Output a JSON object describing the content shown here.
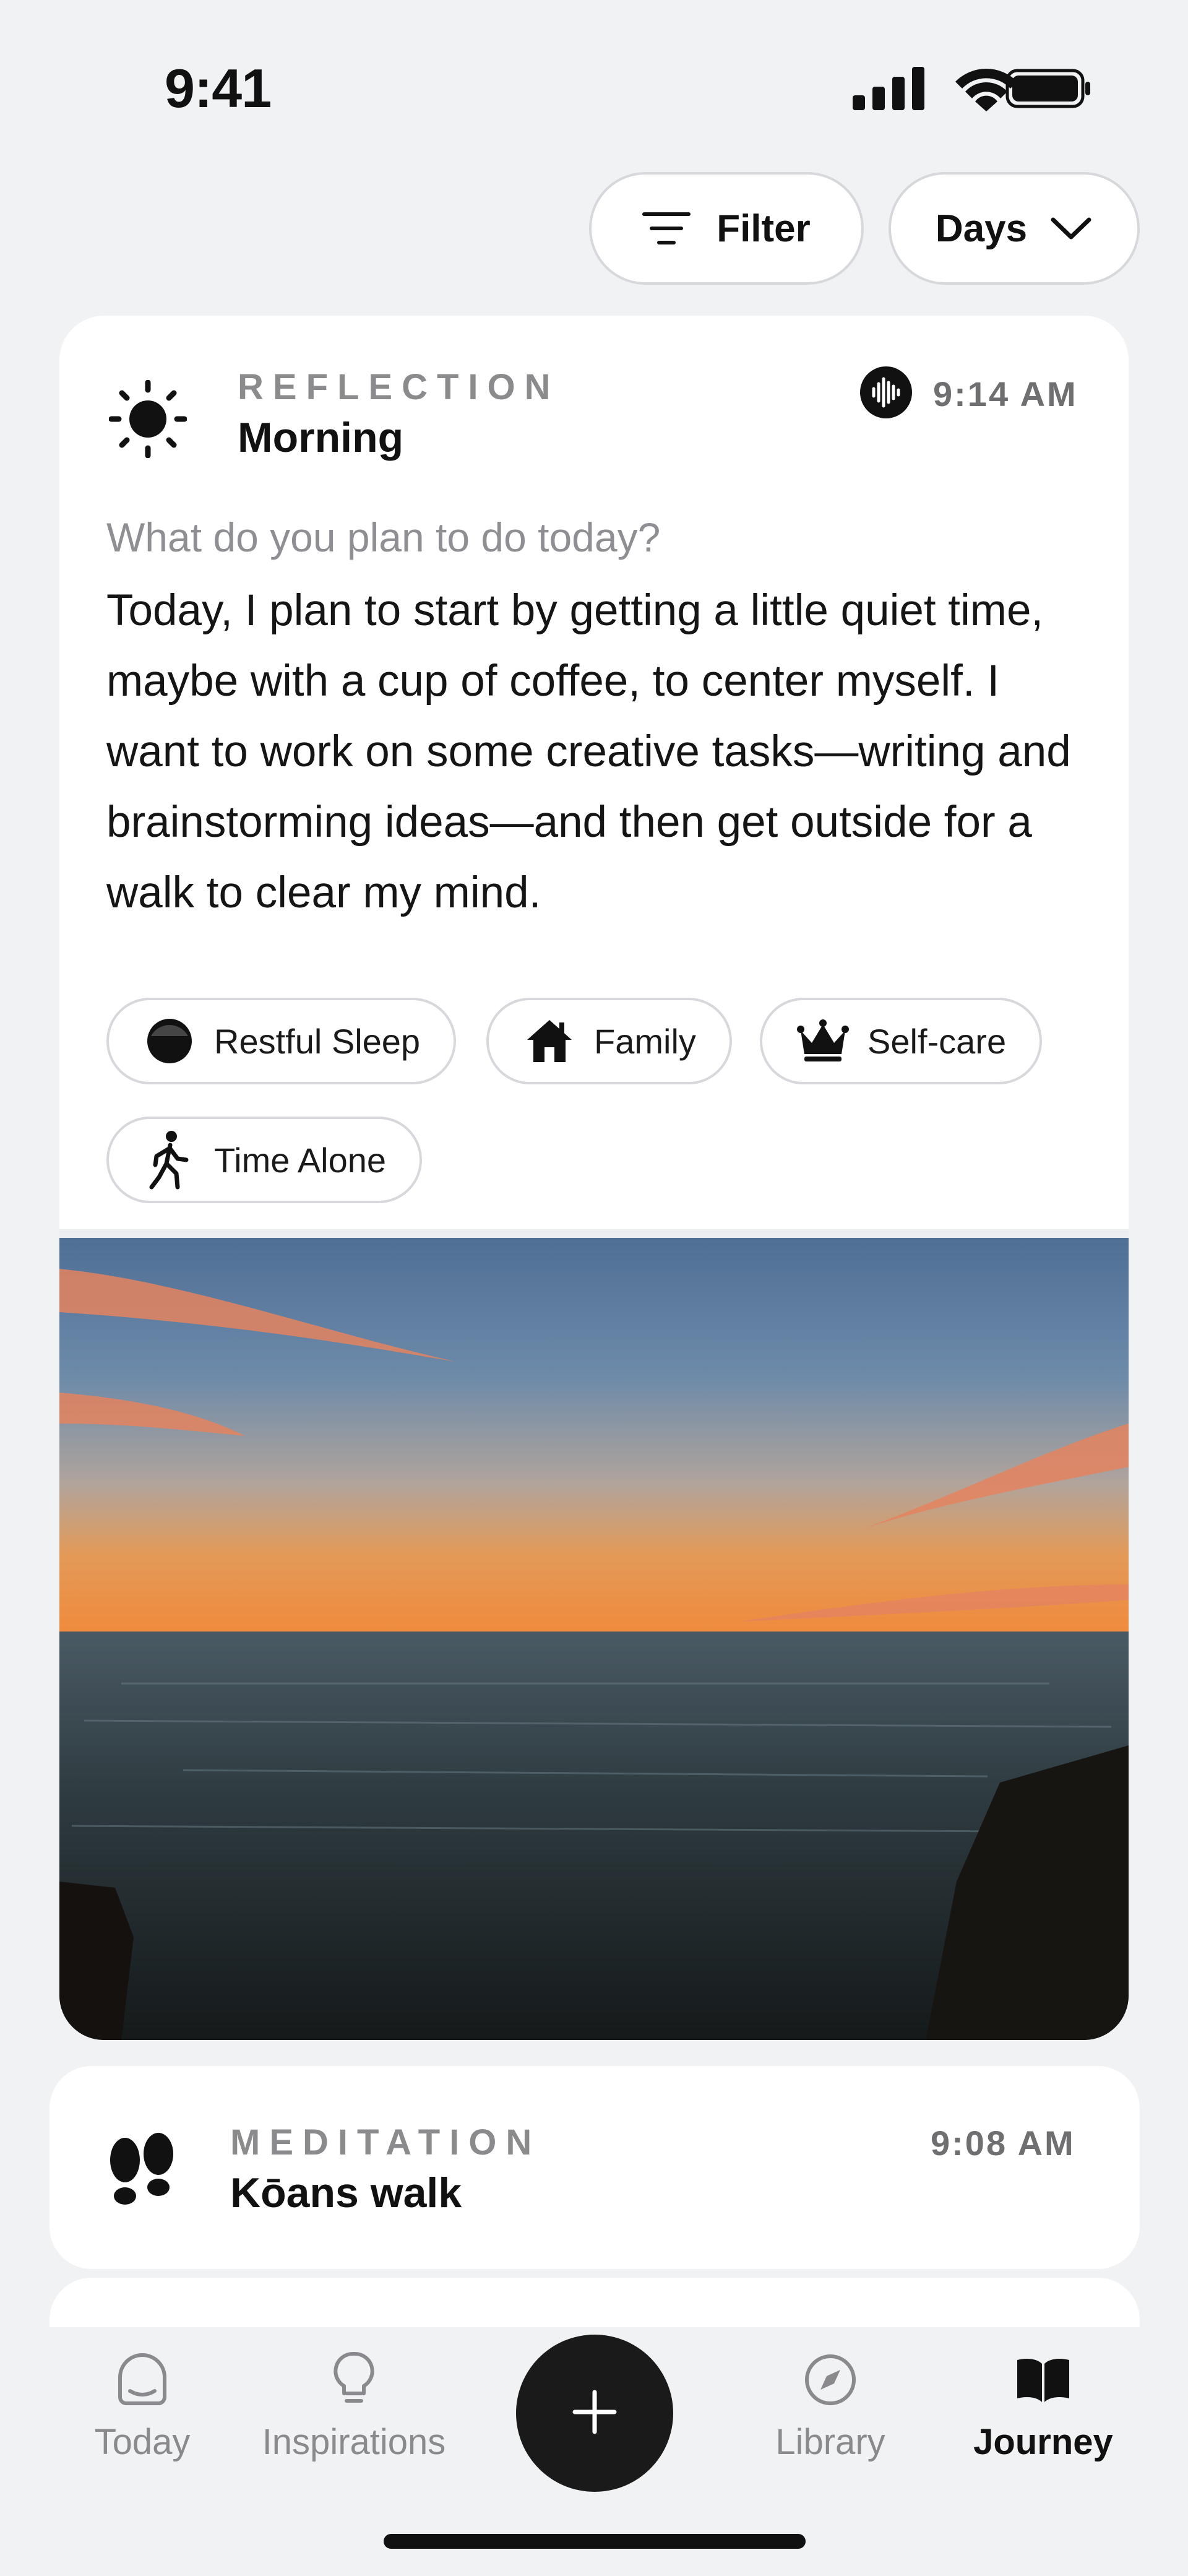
{
  "status_bar": {
    "time": "9:41"
  },
  "controls": {
    "filter_label": "Filter",
    "range_label": "Days"
  },
  "reflection": {
    "kind": "REFLECTION",
    "title": "Morning",
    "time": "9:14 AM",
    "prompt": "What do you plan to do today?",
    "body": "Today, I plan to start by getting a little quiet time, maybe with a cup of coffee, to center myself. I want to work on some creative tasks—writing and brainstorming ideas—and then get outside for a walk to clear my mind.",
    "tags": [
      {
        "label": "Restful Sleep",
        "icon": "moon-icon"
      },
      {
        "label": "Family",
        "icon": "house-icon"
      },
      {
        "label": "Self-care",
        "icon": "crown-icon"
      },
      {
        "label": "Time Alone",
        "icon": "walking-person-icon"
      }
    ],
    "photo_description_icon": "sunset-ocean-photo"
  },
  "meditation": {
    "kind": "MEDITATION",
    "title": "Kōans walk",
    "time": "9:08 AM"
  },
  "tabbar": {
    "items": [
      {
        "label": "Today",
        "icon": "bowl-icon"
      },
      {
        "label": "Inspirations",
        "icon": "lightbulb-icon"
      },
      {
        "label": "Library",
        "icon": "compass-icon"
      },
      {
        "label": "Journey",
        "icon": "book-icon"
      }
    ],
    "active": "Journey"
  },
  "colors": {
    "background": "#f1f2f4",
    "card": "#ffffff",
    "fab": "#1a1a1a",
    "muted_text": "#8b8b8e"
  }
}
